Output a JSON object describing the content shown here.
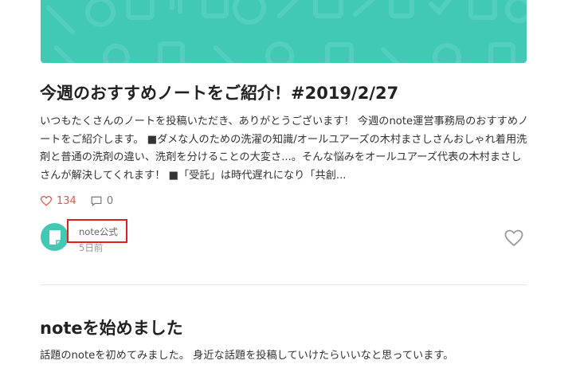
{
  "hero": {
    "color": "#41c9b4"
  },
  "post1": {
    "title": "今週のおすすめノートをご紹介！#2019/2/27",
    "excerpt": "いつもたくさんのノートを投稿いただき、ありがとうございます！ 今週のnote運営事務局のおすすめノートをご紹介します。 ■ダメな人のための洗濯の知識/オールユアーズの木村まさしさんおしゃれ着用洗剤と普通の洗剤の違い、洗剤を分けることの大変さ...。そんな悩みをオールユアーズ代表の木村まさしさんが解決してくれます！ ■「受託」は時代遅れになり「共創...",
    "like_count": "134",
    "comment_count": "0",
    "author": "note公式",
    "date": "5日前"
  },
  "post2": {
    "title": "noteを始めました",
    "excerpt": "話題のnoteを初めてみました。 身近な話題を投稿していけたらいいなと思っています。"
  },
  "colors": {
    "accent": "#41c9b4",
    "like": "#e0584c",
    "highlight_box": "#e02020"
  }
}
